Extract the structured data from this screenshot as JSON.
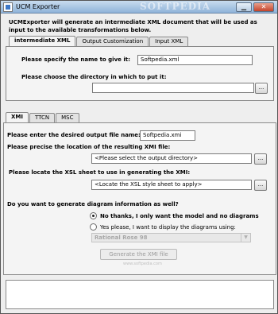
{
  "window": {
    "title": "UCM Exporter",
    "watermark": "SOFTPEDIA",
    "minimize_glyph": "▁",
    "close_glyph": "✕"
  },
  "intro": "UCMExporter will generate an intermediate XML document that will be used as input to the available transformations below.",
  "top_tabs": {
    "tabs": [
      "intermediate XML",
      "Output Customization",
      "Input XML"
    ],
    "active": 0
  },
  "intermediate": {
    "name_label": "Please specify the name to give it:",
    "name_value": "Softpedia.xml",
    "dir_label": "Please choose the directory in which to put it:",
    "dir_value": "",
    "browse_label": "..."
  },
  "bottom_tabs": {
    "tabs": [
      "XMI",
      "TTCN",
      "MSC"
    ],
    "active": 0
  },
  "xmi": {
    "output_name_label": "Please enter the desired output file name:",
    "output_name_value": "Softpedia.xmi",
    "location_label": "Please precise the location of the resulting XMI file:",
    "location_placeholder": "<Please select the output directory>",
    "xsl_label": "Please locate the XSL sheet to use in generating the XMI:",
    "xsl_placeholder": "<Locate the XSL style sheet to apply>",
    "browse_label": "...",
    "diagram_question": "Do you want to generate diagram information as well?",
    "option_no": "No thanks, I only want the model and no diagrams",
    "option_yes": "Yes please, I want to display the diagrams using:",
    "selected_option": "no",
    "tool_value": "Rational Rose 98",
    "generate_label": "Generate the XMI file",
    "generate_overlay": "www.softpedia.com"
  },
  "log_text": ""
}
